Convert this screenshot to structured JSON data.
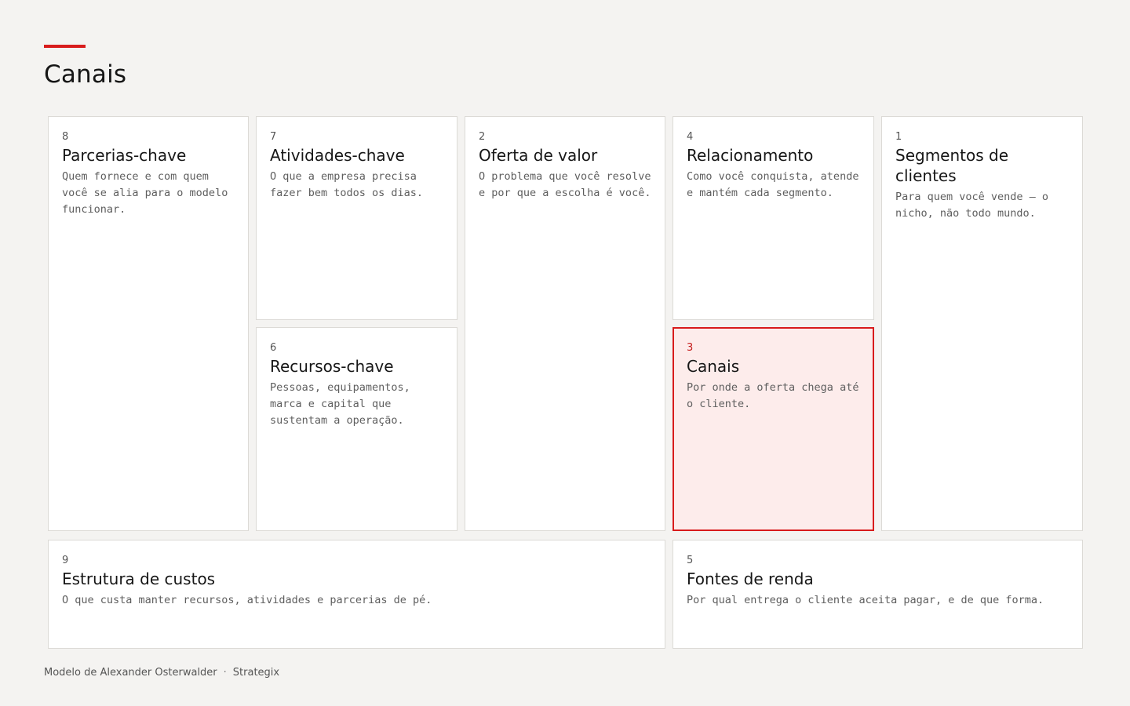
{
  "page": {
    "title": "Canais"
  },
  "colors": {
    "accent": "#d81c1c",
    "active_card_bg": "#fdeceb",
    "background": "#f4f3f1"
  },
  "canvas": {
    "blocks": [
      {
        "id": "parcerias",
        "number": "8",
        "title": "Parcerias-chave",
        "description": "Quem fornece e com quem você se alia para o modelo funcionar.",
        "active": false
      },
      {
        "id": "atividades",
        "number": "7",
        "title": "Atividades-chave",
        "description": "O que a empresa precisa fazer bem todos os dias.",
        "active": false
      },
      {
        "id": "recursos",
        "number": "6",
        "title": "Recursos-chave",
        "description": "Pessoas, equipamentos, marca e capital que sustentam a operação.",
        "active": false
      },
      {
        "id": "oferta",
        "number": "2",
        "title": "Oferta de valor",
        "description": "O problema que você resolve e por que a escolha é você.",
        "active": false
      },
      {
        "id": "relacionamento",
        "number": "4",
        "title": "Relacionamento",
        "description": "Como você conquista, atende e mantém cada segmento.",
        "active": false
      },
      {
        "id": "canais",
        "number": "3",
        "title": "Canais",
        "description": "Por onde a oferta chega até o cliente.",
        "active": true
      },
      {
        "id": "segmentos",
        "number": "1",
        "title": "Segmentos de clientes",
        "description": "Para quem você vende — o nicho, não todo mundo.",
        "active": false
      },
      {
        "id": "custos",
        "number": "9",
        "title": "Estrutura de custos",
        "description": "O que custa manter recursos, atividades e parcerias de pé.",
        "active": false
      },
      {
        "id": "renda",
        "number": "5",
        "title": "Fontes de renda",
        "description": "Por qual entrega o cliente aceita pagar, e de que forma.",
        "active": false
      }
    ]
  },
  "footer": {
    "credit": "Modelo de Alexander Osterwalder",
    "separator": "·",
    "brand": "Strategix"
  }
}
